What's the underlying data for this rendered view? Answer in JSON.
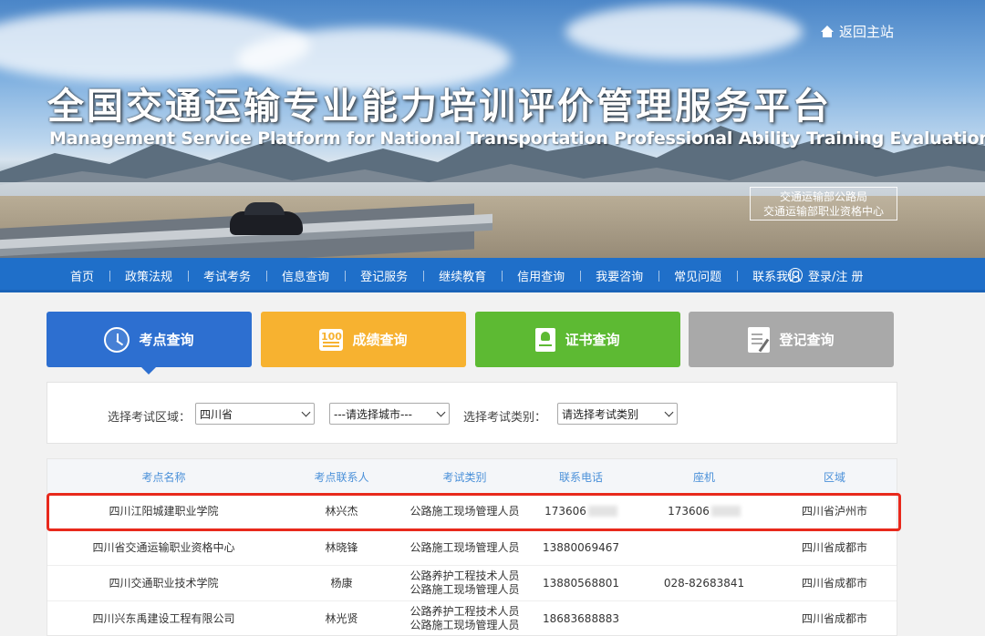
{
  "header": {
    "home_link": "返回主站",
    "title_cn": "全国交通运输专业能力培训评价管理服务平台",
    "title_en": "Management Service Platform for National Transportation Professional Ability Training Evaluation",
    "org_line1": "交通运输部公路局",
    "org_line2": "交通运输部职业资格中心"
  },
  "nav": {
    "items": [
      "首页",
      "政策法规",
      "考试考务",
      "信息查询",
      "登记服务",
      "继续教育",
      "信用查询",
      "我要咨询",
      "常见问题",
      "联系我们"
    ],
    "login": "登录/注 册"
  },
  "tabs": [
    {
      "label": "考点查询",
      "icon": "clock-icon",
      "color": "#2d6fd0"
    },
    {
      "label": "成绩查询",
      "icon": "score-100-icon",
      "icon_text": "100",
      "color": "#f7b230"
    },
    {
      "label": "证书查询",
      "icon": "certificate-icon",
      "color": "#5dba33"
    },
    {
      "label": "登记查询",
      "icon": "register-icon",
      "color": "#a9a9a9"
    }
  ],
  "filter": {
    "region_label": "选择考试区域：",
    "province": "四川省",
    "city": "---请选择城市---",
    "category_label": "选择考试类别：",
    "category": "请选择考试类别"
  },
  "table": {
    "headers": [
      "考点名称",
      "考点联系人",
      "考试类别",
      "联系电话",
      "座机",
      "区域"
    ],
    "rows": [
      {
        "name": "四川江阳城建职业学院",
        "contact": "林兴杰",
        "category_1": "公路施工现场管理人员",
        "category_2": "",
        "phone": "173606",
        "landline": "173606",
        "region": "四川省泸州市"
      },
      {
        "name": "四川省交通运输职业资格中心",
        "contact": "林晓锋",
        "category_1": "公路施工现场管理人员",
        "category_2": "",
        "phone": "13880069467",
        "landline": "",
        "region": "四川省成都市"
      },
      {
        "name": "四川交通职业技术学院",
        "contact": "杨康",
        "category_1": "公路养护工程技术人员",
        "category_2": "公路施工现场管理人员",
        "phone": "13880568801",
        "landline": "028-82683841",
        "region": "四川省成都市"
      },
      {
        "name": "四川兴东禹建设工程有限公司",
        "contact": "林光贤",
        "category_1": "公路养护工程技术人员",
        "category_2": "公路施工现场管理人员",
        "phone": "18683688883",
        "landline": "",
        "region": "四川省成都市"
      }
    ]
  },
  "colors": {
    "nav": "#1f6fc9",
    "header_text": "#4a90d9",
    "highlight": "#e8291c"
  }
}
